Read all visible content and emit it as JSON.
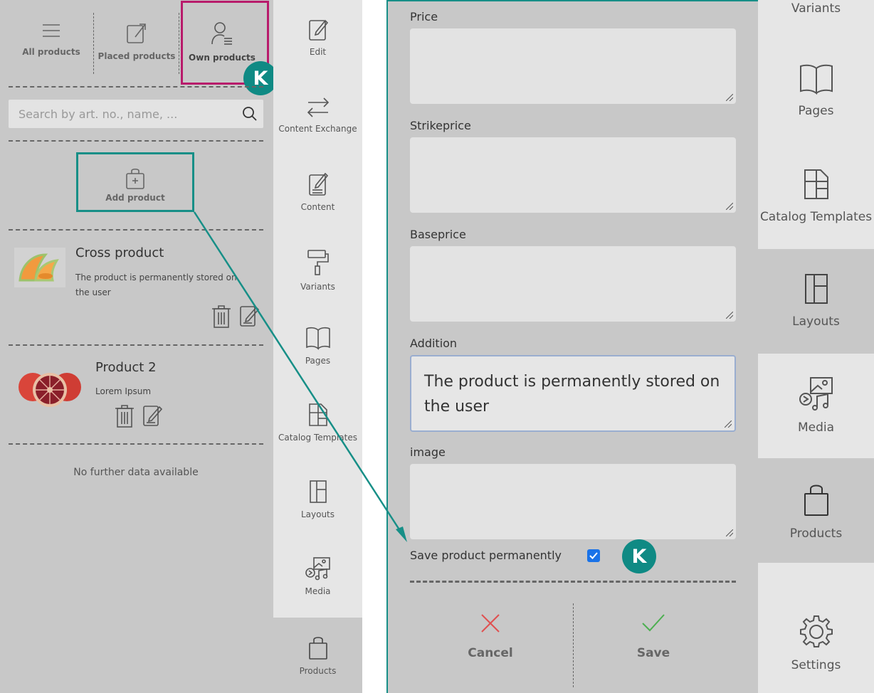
{
  "tabs": {
    "all_products": "All products",
    "placed_products": "Placed products",
    "own_products": "Own products"
  },
  "badge_letter": "K",
  "search": {
    "placeholder": "Search by art. no., name, ..."
  },
  "add_product_label": "Add product",
  "products": [
    {
      "name": "Cross product",
      "description": "The product is permanently stored on the user",
      "image": "melon-slices"
    },
    {
      "name": "Product 2",
      "description": "Lorem Ipsum",
      "image": "blood-oranges"
    }
  ],
  "no_data": "No further data available",
  "middle_sidebar": [
    {
      "label": "Edit",
      "icon": "edit-icon"
    },
    {
      "label": "Content Exchange",
      "icon": "exchange-icon"
    },
    {
      "label": "Content",
      "icon": "content-icon"
    },
    {
      "label": "Variants",
      "icon": "paint-roller-icon"
    },
    {
      "label": "Pages",
      "icon": "book-icon"
    },
    {
      "label": "Catalog Templates",
      "icon": "template-icon"
    },
    {
      "label": "Layouts",
      "icon": "layout-icon"
    },
    {
      "label": "Media",
      "icon": "media-icon"
    },
    {
      "label": "Products",
      "icon": "bag-icon"
    }
  ],
  "form": {
    "fields": [
      {
        "label": "Price",
        "value": ""
      },
      {
        "label": "Strikeprice",
        "value": ""
      },
      {
        "label": "Baseprice",
        "value": ""
      },
      {
        "label": "Addition",
        "value": "The product is permanently stored on the user"
      },
      {
        "label": "image",
        "value": ""
      }
    ],
    "save_permanently_label": "Save product permanently",
    "save_permanently_checked": true,
    "cancel_label": "Cancel",
    "save_label": "Save"
  },
  "right_sidebar": [
    {
      "label": "Variants",
      "icon": "paint-roller-icon"
    },
    {
      "label": "Pages",
      "icon": "book-icon"
    },
    {
      "label": "Catalog Templates",
      "icon": "template-icon"
    },
    {
      "label": "Layouts",
      "icon": "layout-icon"
    },
    {
      "label": "Media",
      "icon": "media-icon"
    },
    {
      "label": "Products",
      "icon": "bag-icon"
    },
    {
      "label": "Settings",
      "icon": "gear-icon"
    }
  ],
  "colors": {
    "highlight_magenta": "#b81b6b",
    "accent_teal": "#178f87",
    "badge_teal": "#0f8a84",
    "cancel_red": "#e05050",
    "save_green": "#4caf50",
    "checkbox_blue": "#1a73e8"
  }
}
